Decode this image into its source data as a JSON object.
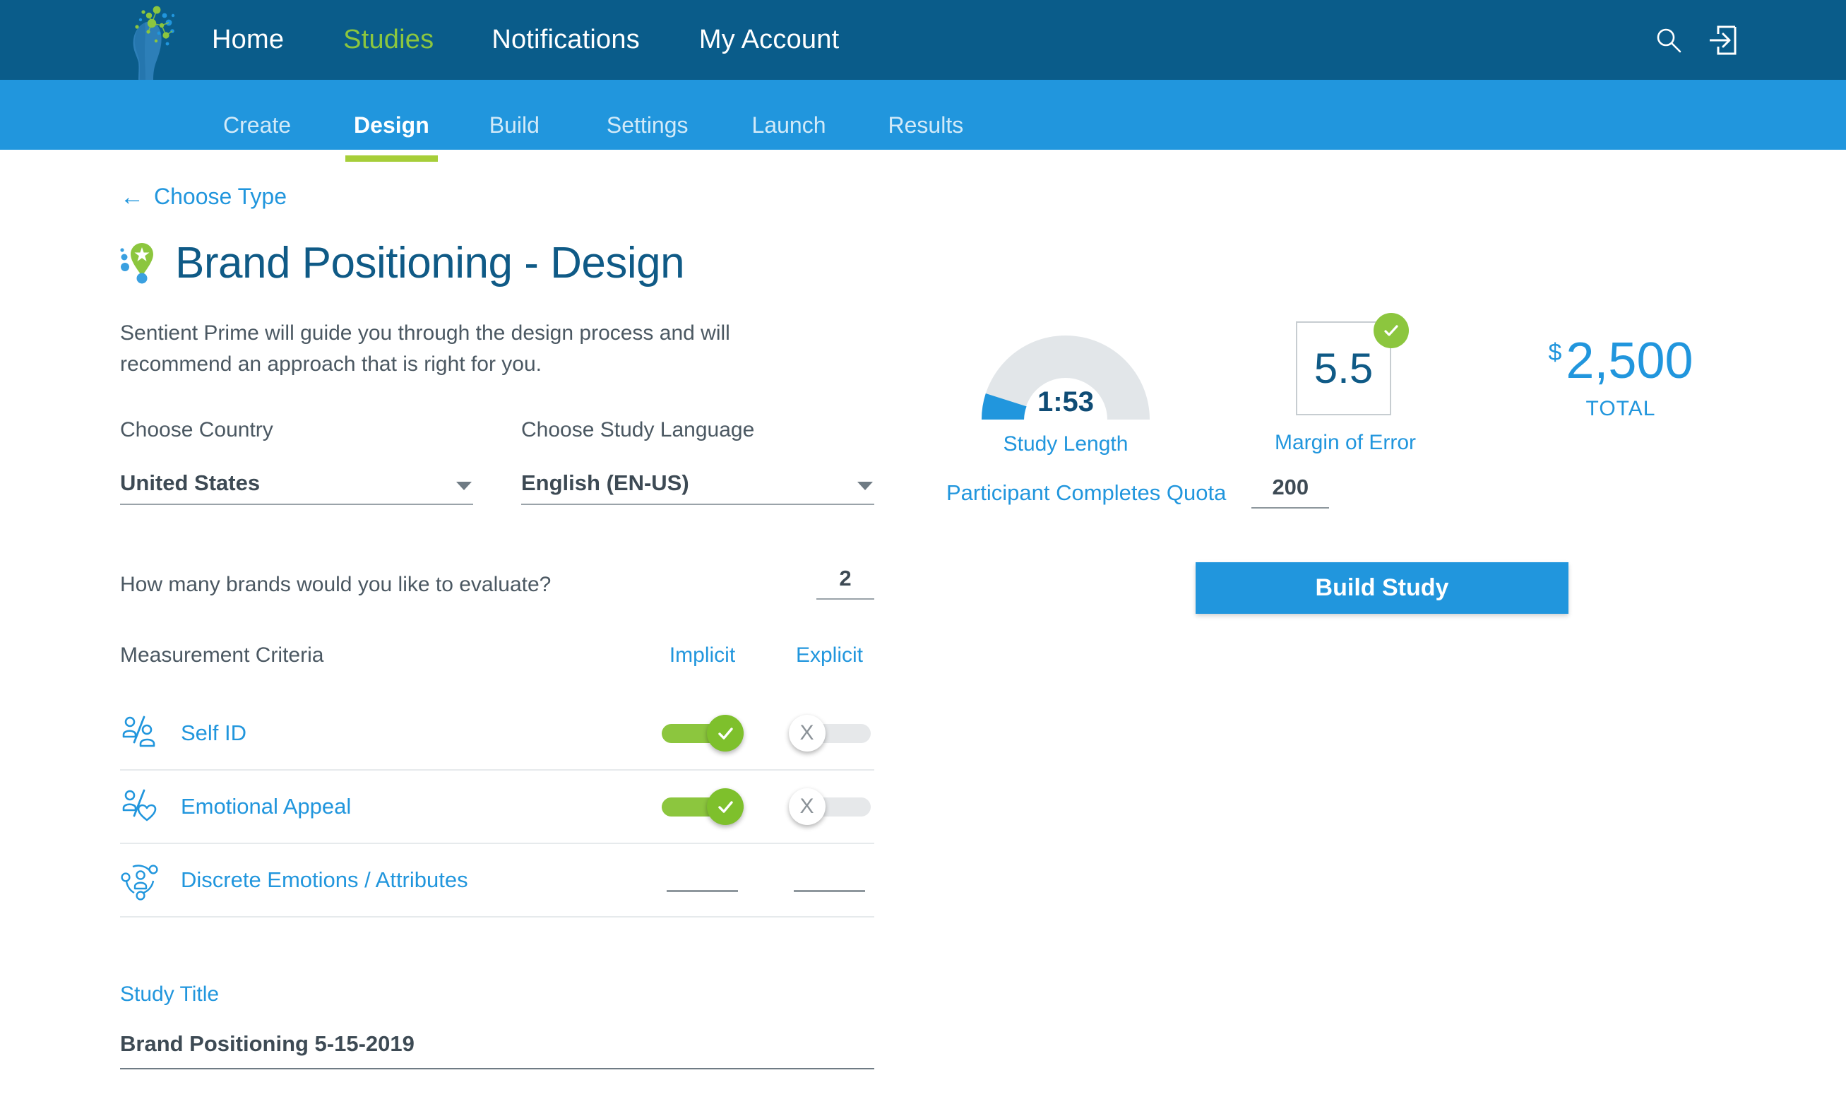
{
  "brand": {
    "logo_icon": "head-with-network-dots-logo",
    "accent_blue": "#2196dd",
    "dark_blue": "#0a5c8a",
    "green": "#8cc63e"
  },
  "topnav": {
    "links": [
      {
        "label": "Home"
      },
      {
        "label": "Studies"
      },
      {
        "label": "Notifications"
      },
      {
        "label": "My Account"
      }
    ],
    "icons": [
      {
        "name": "search-icon"
      },
      {
        "name": "logout-icon"
      }
    ]
  },
  "subnav": {
    "items": [
      {
        "label": "Create"
      },
      {
        "label": "Design"
      },
      {
        "label": "Build"
      },
      {
        "label": "Settings"
      },
      {
        "label": "Launch"
      },
      {
        "label": "Results"
      }
    ],
    "active": "Design"
  },
  "main": {
    "back_link": "Choose Type",
    "page_title": "Brand Positioning - Design",
    "title_icon": "location-pin-idea-icon",
    "intro": "Sentient Prime will guide you through the design process and will recommend an approach that is right for you.",
    "country": {
      "label": "Choose Country",
      "value": "United States"
    },
    "language": {
      "label": "Choose Study Language",
      "value": "English (EN-US)"
    },
    "brands_question": {
      "label": "How many brands would you like to evaluate?",
      "value": "2"
    },
    "criteria": {
      "title": "Measurement Criteria",
      "col_implicit": "Implicit",
      "col_explicit": "Explicit",
      "rows": [
        {
          "label": "Self ID",
          "icon": "two-people-compare-icon",
          "implicit": "on",
          "explicit": "off"
        },
        {
          "label": "Emotional Appeal",
          "icon": "person-heart-compare-icon",
          "implicit": "on",
          "explicit": "off"
        },
        {
          "label": "Discrete Emotions / Attributes",
          "icon": "person-network-icon",
          "implicit": "empty",
          "explicit": "empty"
        }
      ]
    },
    "study_title": {
      "label": "Study Title",
      "value": "Brand Positioning 5-15-2019"
    }
  },
  "summary": {
    "study_length": {
      "value": "1:53",
      "caption": "Study Length",
      "fill_percent": 10
    },
    "margin_of_error": {
      "value": "5.5",
      "caption": "Margin of Error",
      "status_icon": "check-circle-icon"
    },
    "total": {
      "currency": "$",
      "amount": "2,500",
      "caption": "TOTAL"
    },
    "quota": {
      "label": "Participant Completes Quota",
      "value": "200"
    },
    "build_button": "Build Study"
  }
}
